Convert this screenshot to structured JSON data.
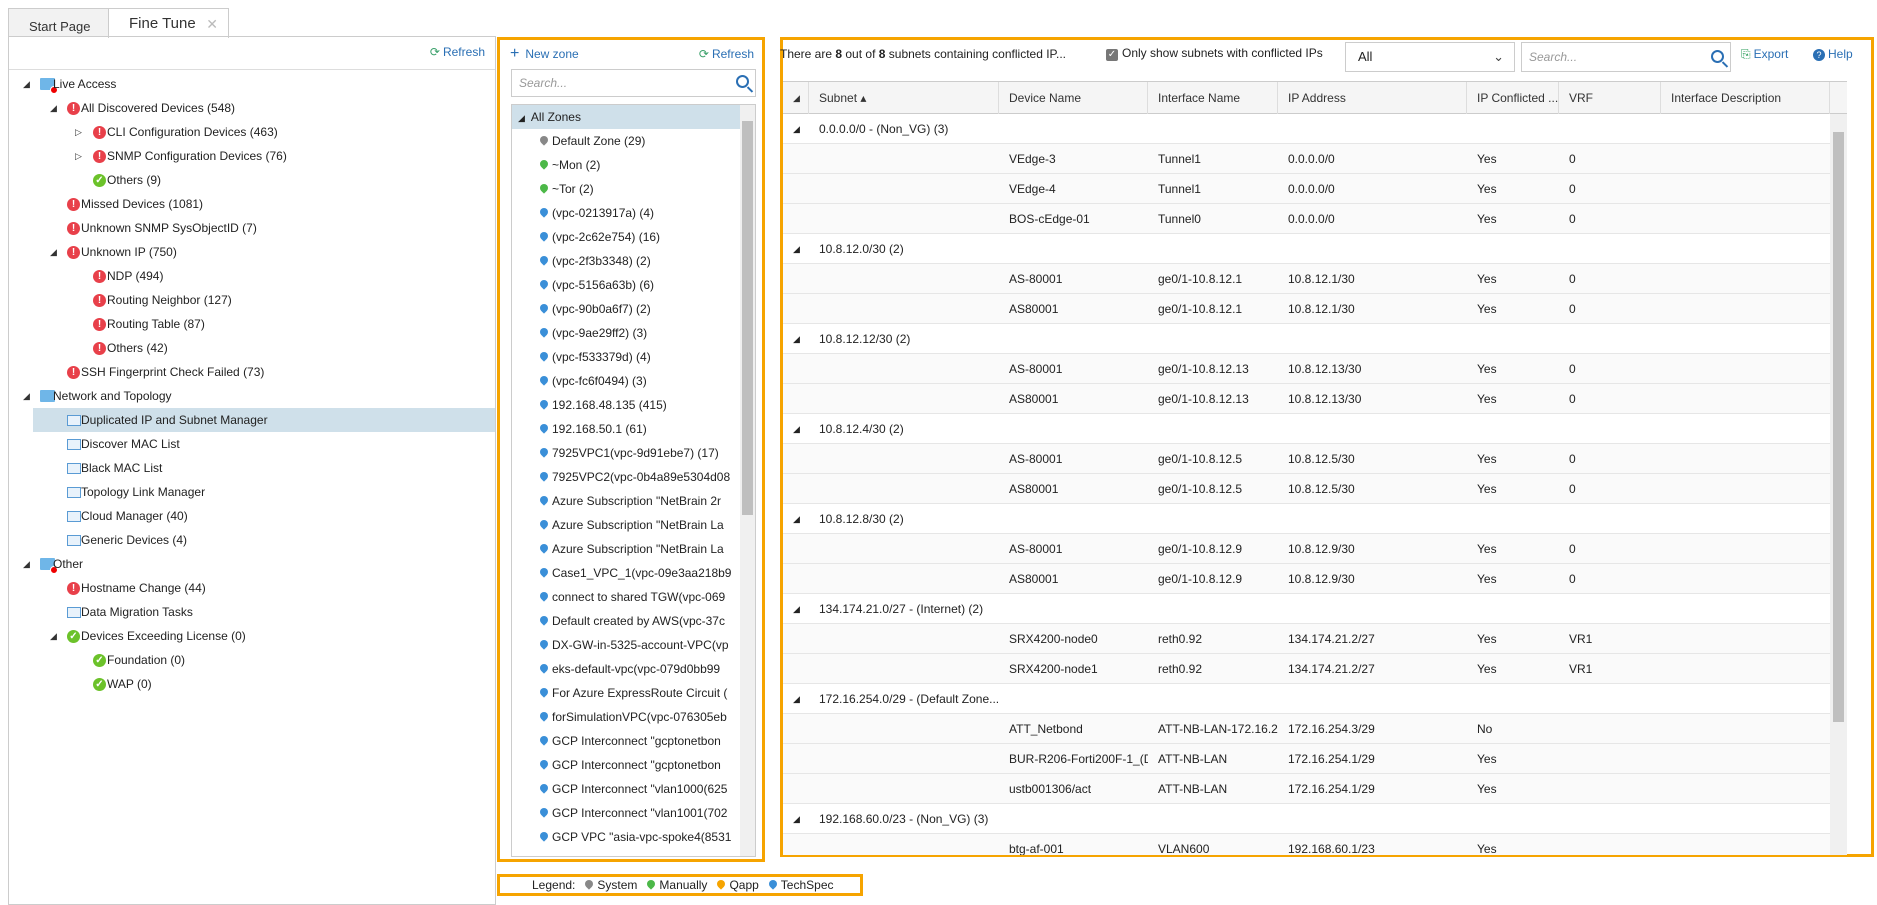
{
  "tabs": [
    {
      "label": "Start Page"
    },
    {
      "label": "Fine Tune"
    }
  ],
  "left": {
    "refresh": "Refresh",
    "tree": [
      {
        "label": "Live Access",
        "level": 0,
        "toggle": "expanded",
        "icon": "folder-alert"
      },
      {
        "label": "All Discovered Devices (548)",
        "level": 1,
        "toggle": "expanded",
        "icon": "error"
      },
      {
        "label": "CLI Configuration Devices (463)",
        "level": 2,
        "toggle": "collapsed",
        "icon": "error"
      },
      {
        "label": "SNMP Configuration Devices (76)",
        "level": 2,
        "toggle": "collapsed",
        "icon": "error"
      },
      {
        "label": "Others (9)",
        "level": 2,
        "toggle": "none",
        "icon": "ok"
      },
      {
        "label": "Missed Devices (1081)",
        "level": 1,
        "toggle": "none",
        "icon": "error"
      },
      {
        "label": "Unknown SNMP SysObjectID (7)",
        "level": 1,
        "toggle": "none",
        "icon": "error"
      },
      {
        "label": "Unknown IP (750)",
        "level": 1,
        "toggle": "expanded",
        "icon": "error"
      },
      {
        "label": "NDP (494)",
        "level": 2,
        "toggle": "none",
        "icon": "error"
      },
      {
        "label": "Routing Neighbor (127)",
        "level": 2,
        "toggle": "none",
        "icon": "error"
      },
      {
        "label": "Routing Table (87)",
        "level": 2,
        "toggle": "none",
        "icon": "error"
      },
      {
        "label": "Others (42)",
        "level": 2,
        "toggle": "none",
        "icon": "error"
      },
      {
        "label": "SSH Fingerprint Check Failed (73)",
        "level": 1,
        "toggle": "none",
        "icon": "error"
      },
      {
        "label": "Network and Topology",
        "level": 0,
        "toggle": "expanded",
        "icon": "folder"
      },
      {
        "label": "Duplicated IP and Subnet Manager",
        "level": 1,
        "toggle": "none",
        "icon": "page",
        "selected": true
      },
      {
        "label": "Discover MAC List",
        "level": 1,
        "toggle": "none",
        "icon": "page"
      },
      {
        "label": "Black MAC List",
        "level": 1,
        "toggle": "none",
        "icon": "page"
      },
      {
        "label": "Topology Link Manager",
        "level": 1,
        "toggle": "none",
        "icon": "page"
      },
      {
        "label": "Cloud Manager (40)",
        "level": 1,
        "toggle": "none",
        "icon": "page"
      },
      {
        "label": "Generic Devices (4)",
        "level": 1,
        "toggle": "none",
        "icon": "page"
      },
      {
        "label": "Other",
        "level": 0,
        "toggle": "expanded",
        "icon": "folder-alert"
      },
      {
        "label": "Hostname Change (44)",
        "level": 1,
        "toggle": "none",
        "icon": "error"
      },
      {
        "label": "Data Migration Tasks",
        "level": 1,
        "toggle": "none",
        "icon": "page"
      },
      {
        "label": "Devices Exceeding License (0)",
        "level": 1,
        "toggle": "expanded",
        "icon": "ok"
      },
      {
        "label": "Foundation (0)",
        "level": 2,
        "toggle": "none",
        "icon": "ok"
      },
      {
        "label": "WAP (0)",
        "level": 2,
        "toggle": "none",
        "icon": "ok"
      }
    ]
  },
  "zones": {
    "new_zone": "New zone",
    "refresh": "Refresh",
    "search_placeholder": "Search...",
    "root": "All Zones",
    "items": [
      {
        "label": "Default Zone (29)",
        "type": "system"
      },
      {
        "label": "~Mon (2)",
        "type": "manually"
      },
      {
        "label": "~Tor (2)",
        "type": "manually"
      },
      {
        "label": "(vpc-0213917a) (4)",
        "type": "techspec"
      },
      {
        "label": "(vpc-2c62e754) (16)",
        "type": "techspec"
      },
      {
        "label": "(vpc-2f3b3348) (2)",
        "type": "techspec"
      },
      {
        "label": "(vpc-5156a63b) (6)",
        "type": "techspec"
      },
      {
        "label": "(vpc-90b0a6f7) (2)",
        "type": "techspec"
      },
      {
        "label": "(vpc-9ae29ff2) (3)",
        "type": "techspec"
      },
      {
        "label": "(vpc-f533379d) (4)",
        "type": "techspec"
      },
      {
        "label": "(vpc-fc6f0494) (3)",
        "type": "techspec"
      },
      {
        "label": "192.168.48.135 (415)",
        "type": "techspec"
      },
      {
        "label": "192.168.50.1 (61)",
        "type": "techspec"
      },
      {
        "label": "7925VPC1(vpc-9d91ebe7) (17)",
        "type": "techspec"
      },
      {
        "label": "7925VPC2(vpc-0b4a89e5304d08",
        "type": "techspec"
      },
      {
        "label": "Azure Subscription \"NetBrain 2r",
        "type": "techspec"
      },
      {
        "label": "Azure Subscription \"NetBrain La",
        "type": "techspec"
      },
      {
        "label": "Azure Subscription \"NetBrain La",
        "type": "techspec"
      },
      {
        "label": "Case1_VPC_1(vpc-09e3aa218b9",
        "type": "techspec"
      },
      {
        "label": "connect to shared TGW(vpc-069",
        "type": "techspec"
      },
      {
        "label": "Default created by AWS(vpc-37c",
        "type": "techspec"
      },
      {
        "label": "DX-GW-in-5325-account-VPC(vp",
        "type": "techspec"
      },
      {
        "label": "eks-default-vpc(vpc-079d0bb99",
        "type": "techspec"
      },
      {
        "label": "For Azure ExpressRoute Circuit (",
        "type": "techspec"
      },
      {
        "label": "forSimulationVPC(vpc-076305eb",
        "type": "techspec"
      },
      {
        "label": "GCP Interconnect \"gcptonetbon",
        "type": "techspec"
      },
      {
        "label": "GCP Interconnect \"gcptonetbon",
        "type": "techspec"
      },
      {
        "label": "GCP Interconnect \"vlan1000(625",
        "type": "techspec"
      },
      {
        "label": "GCP Interconnect \"vlan1001(702",
        "type": "techspec"
      },
      {
        "label": "GCP VPC \"asia-vpc-spoke4(8531",
        "type": "techspec"
      }
    ]
  },
  "legend": {
    "label": "Legend:",
    "items": [
      {
        "label": "System",
        "type": "system"
      },
      {
        "label": "Manually",
        "type": "manually"
      },
      {
        "label": "Qapp",
        "type": "qapp"
      },
      {
        "label": "TechSpec",
        "type": "techspec"
      }
    ]
  },
  "colors": {
    "system": "#888888",
    "manually": "#4cb848",
    "qapp": "#f6a400",
    "techspec": "#3a8fd8",
    "accent": "#f6a400"
  },
  "main": {
    "summary_prefix": "There are ",
    "summary_count": "8",
    "summary_mid": " out of ",
    "summary_total": "8",
    "summary_suffix": " subnets containing conflicted IP...",
    "only_conflicted_label": "Only show subnets with conflicted IPs",
    "only_conflicted_checked": true,
    "filter_value": "All",
    "search_placeholder": "Search...",
    "export": "Export",
    "help": "Help",
    "columns": [
      "Subnet ▴",
      "Device Name",
      "Interface Name",
      "IP Address",
      "IP Conflicted ...",
      "VRF",
      "Interface Description"
    ],
    "groups": [
      {
        "subnet": "0.0.0.0/0 - (Non_VG) (3)",
        "rows": [
          [
            "VEdge-3",
            "Tunnel1",
            "0.0.0.0/0",
            "Yes",
            "0",
            ""
          ],
          [
            "VEdge-4",
            "Tunnel1",
            "0.0.0.0/0",
            "Yes",
            "0",
            ""
          ],
          [
            "BOS-cEdge-01",
            "Tunnel0",
            "0.0.0.0/0",
            "Yes",
            "0",
            ""
          ]
        ]
      },
      {
        "subnet": "10.8.12.0/30 (2)",
        "rows": [
          [
            "AS-80001",
            "ge0/1-10.8.12.1",
            "10.8.12.1/30",
            "Yes",
            "0",
            ""
          ],
          [
            "AS80001",
            "ge0/1-10.8.12.1",
            "10.8.12.1/30",
            "Yes",
            "0",
            ""
          ]
        ]
      },
      {
        "subnet": "10.8.12.12/30 (2)",
        "rows": [
          [
            "AS-80001",
            "ge0/1-10.8.12.13",
            "10.8.12.13/30",
            "Yes",
            "0",
            ""
          ],
          [
            "AS80001",
            "ge0/1-10.8.12.13",
            "10.8.12.13/30",
            "Yes",
            "0",
            ""
          ]
        ]
      },
      {
        "subnet": "10.8.12.4/30 (2)",
        "rows": [
          [
            "AS-80001",
            "ge0/1-10.8.12.5",
            "10.8.12.5/30",
            "Yes",
            "0",
            ""
          ],
          [
            "AS80001",
            "ge0/1-10.8.12.5",
            "10.8.12.5/30",
            "Yes",
            "0",
            ""
          ]
        ]
      },
      {
        "subnet": "10.8.12.8/30 (2)",
        "rows": [
          [
            "AS-80001",
            "ge0/1-10.8.12.9",
            "10.8.12.9/30",
            "Yes",
            "0",
            ""
          ],
          [
            "AS80001",
            "ge0/1-10.8.12.9",
            "10.8.12.9/30",
            "Yes",
            "0",
            ""
          ]
        ]
      },
      {
        "subnet": "134.174.21.0/27 - (Internet) (2)",
        "rows": [
          [
            "SRX4200-node0",
            "reth0.92",
            "134.174.21.2/27",
            "Yes",
            "VR1",
            ""
          ],
          [
            "SRX4200-node1",
            "reth0.92",
            "134.174.21.2/27",
            "Yes",
            "VR1",
            ""
          ]
        ]
      },
      {
        "subnet": "172.16.254.0/29 - (Default Zone...",
        "rows": [
          [
            "ATT_Netbond",
            "ATT-NB-LAN-172.16.2...",
            "172.16.254.3/29",
            "No",
            "",
            ""
          ],
          [
            "BUR-R206-Forti200F-1_(D...",
            "ATT-NB-LAN",
            "172.16.254.1/29",
            "Yes",
            "",
            ""
          ],
          [
            "ustb001306/act",
            "ATT-NB-LAN",
            "172.16.254.1/29",
            "Yes",
            "",
            ""
          ]
        ]
      },
      {
        "subnet": "192.168.60.0/23 - (Non_VG) (3)",
        "rows": [
          [
            "btg-af-001",
            "VLAN600",
            "192.168.60.1/23",
            "Yes",
            "",
            ""
          ]
        ]
      }
    ]
  }
}
